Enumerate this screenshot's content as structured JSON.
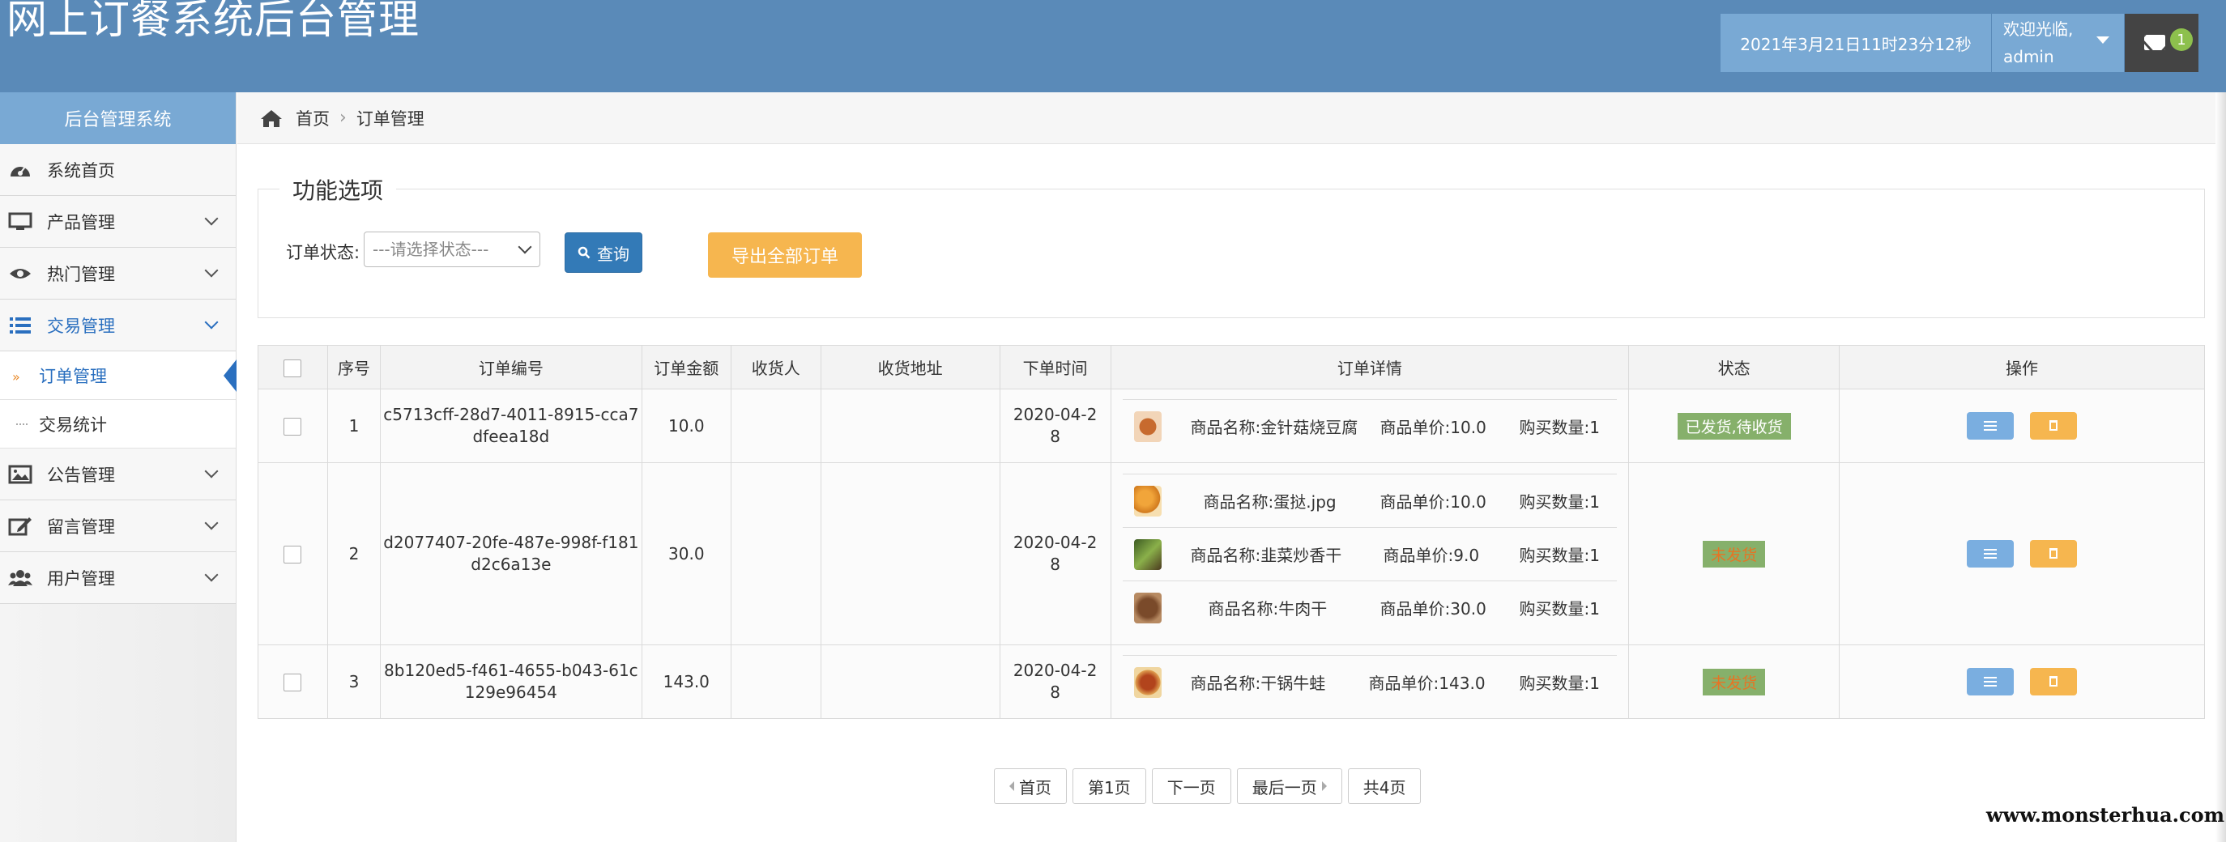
{
  "header": {
    "title": "网上订餐系统后台管理",
    "datetime": "2021年3月21日11时23分12秒",
    "welcome_line1": "欢迎光临,",
    "welcome_user": "admin",
    "mail_badge": "1",
    "bg_color": "#5a8ab8"
  },
  "sidebar": {
    "title": "后台管理系统",
    "items": [
      {
        "label": "系统首页",
        "icon": "dashboard-icon"
      },
      {
        "label": "产品管理",
        "icon": "monitor-icon"
      },
      {
        "label": "热门管理",
        "icon": "eye-icon"
      },
      {
        "label": "交易管理",
        "icon": "list-icon"
      },
      {
        "label": "公告管理",
        "icon": "image-icon"
      },
      {
        "label": "留言管理",
        "icon": "edit-icon"
      },
      {
        "label": "用户管理",
        "icon": "users-icon"
      }
    ],
    "sub_items": [
      {
        "label": "订单管理"
      },
      {
        "label": "交易统计"
      }
    ]
  },
  "breadcrumb": {
    "home": "首页",
    "current": "订单管理"
  },
  "filters": {
    "legend": "功能选项",
    "status_label": "订单状态:",
    "status_placeholder": "---请选择状态---",
    "query_label": "查询",
    "export_label": "导出全部订单"
  },
  "table": {
    "headers": [
      "序号",
      "订单编号",
      "订单金额",
      "收货人",
      "收货地址",
      "下单时间",
      "订单详情",
      "状态",
      "操作"
    ],
    "rows": [
      {
        "index": "1",
        "order_id_l1": "c5713cff-28d7-4011-8915-cca7",
        "order_id_l2": "dfeea18d",
        "amount": "10.0",
        "receiver": "",
        "address": "",
        "date_l1": "2020-04-2",
        "date_l2": "8",
        "status": "已发货,待收货",
        "items": [
          {
            "name": "商品名称:金针菇烧豆腐",
            "price": "商品单价:10.0",
            "qty": "购买数量:1"
          }
        ]
      },
      {
        "index": "2",
        "order_id_l1": "d2077407-20fe-487e-998f-f181",
        "order_id_l2": "d2c6a13e",
        "amount": "30.0",
        "receiver": "",
        "address": "",
        "date_l1": "2020-04-2",
        "date_l2": "8",
        "status": "未发货",
        "items": [
          {
            "name": "商品名称:蛋挞.jpg",
            "price": "商品单价:10.0",
            "qty": "购买数量:1"
          },
          {
            "name": "商品名称:韭菜炒香干",
            "price": "商品单价:9.0",
            "qty": "购买数量:1"
          },
          {
            "name": "商品名称:牛肉干",
            "price": "商品单价:30.0",
            "qty": "购买数量:1"
          }
        ]
      },
      {
        "index": "3",
        "order_id_l1": "8b120ed5-f461-4655-b043-61c",
        "order_id_l2": "129e96454",
        "amount": "143.0",
        "receiver": "",
        "address": "",
        "date_l1": "2020-04-2",
        "date_l2": "8",
        "status": "未发货",
        "items": [
          {
            "name": "商品名称:干锅牛蛙",
            "price": "商品单价:143.0",
            "qty": "购买数量:1"
          }
        ]
      }
    ]
  },
  "pagination": {
    "first": "首页",
    "page": "第1页",
    "next": "下一页",
    "last": "最后一页",
    "total": "共4页"
  },
  "watermark": "www.monsterhua.com",
  "colors": {
    "accent": "#337ab7",
    "export": "#f6b64f",
    "status_shipped": "#86b06b",
    "status_pending_text": "#e77424"
  }
}
